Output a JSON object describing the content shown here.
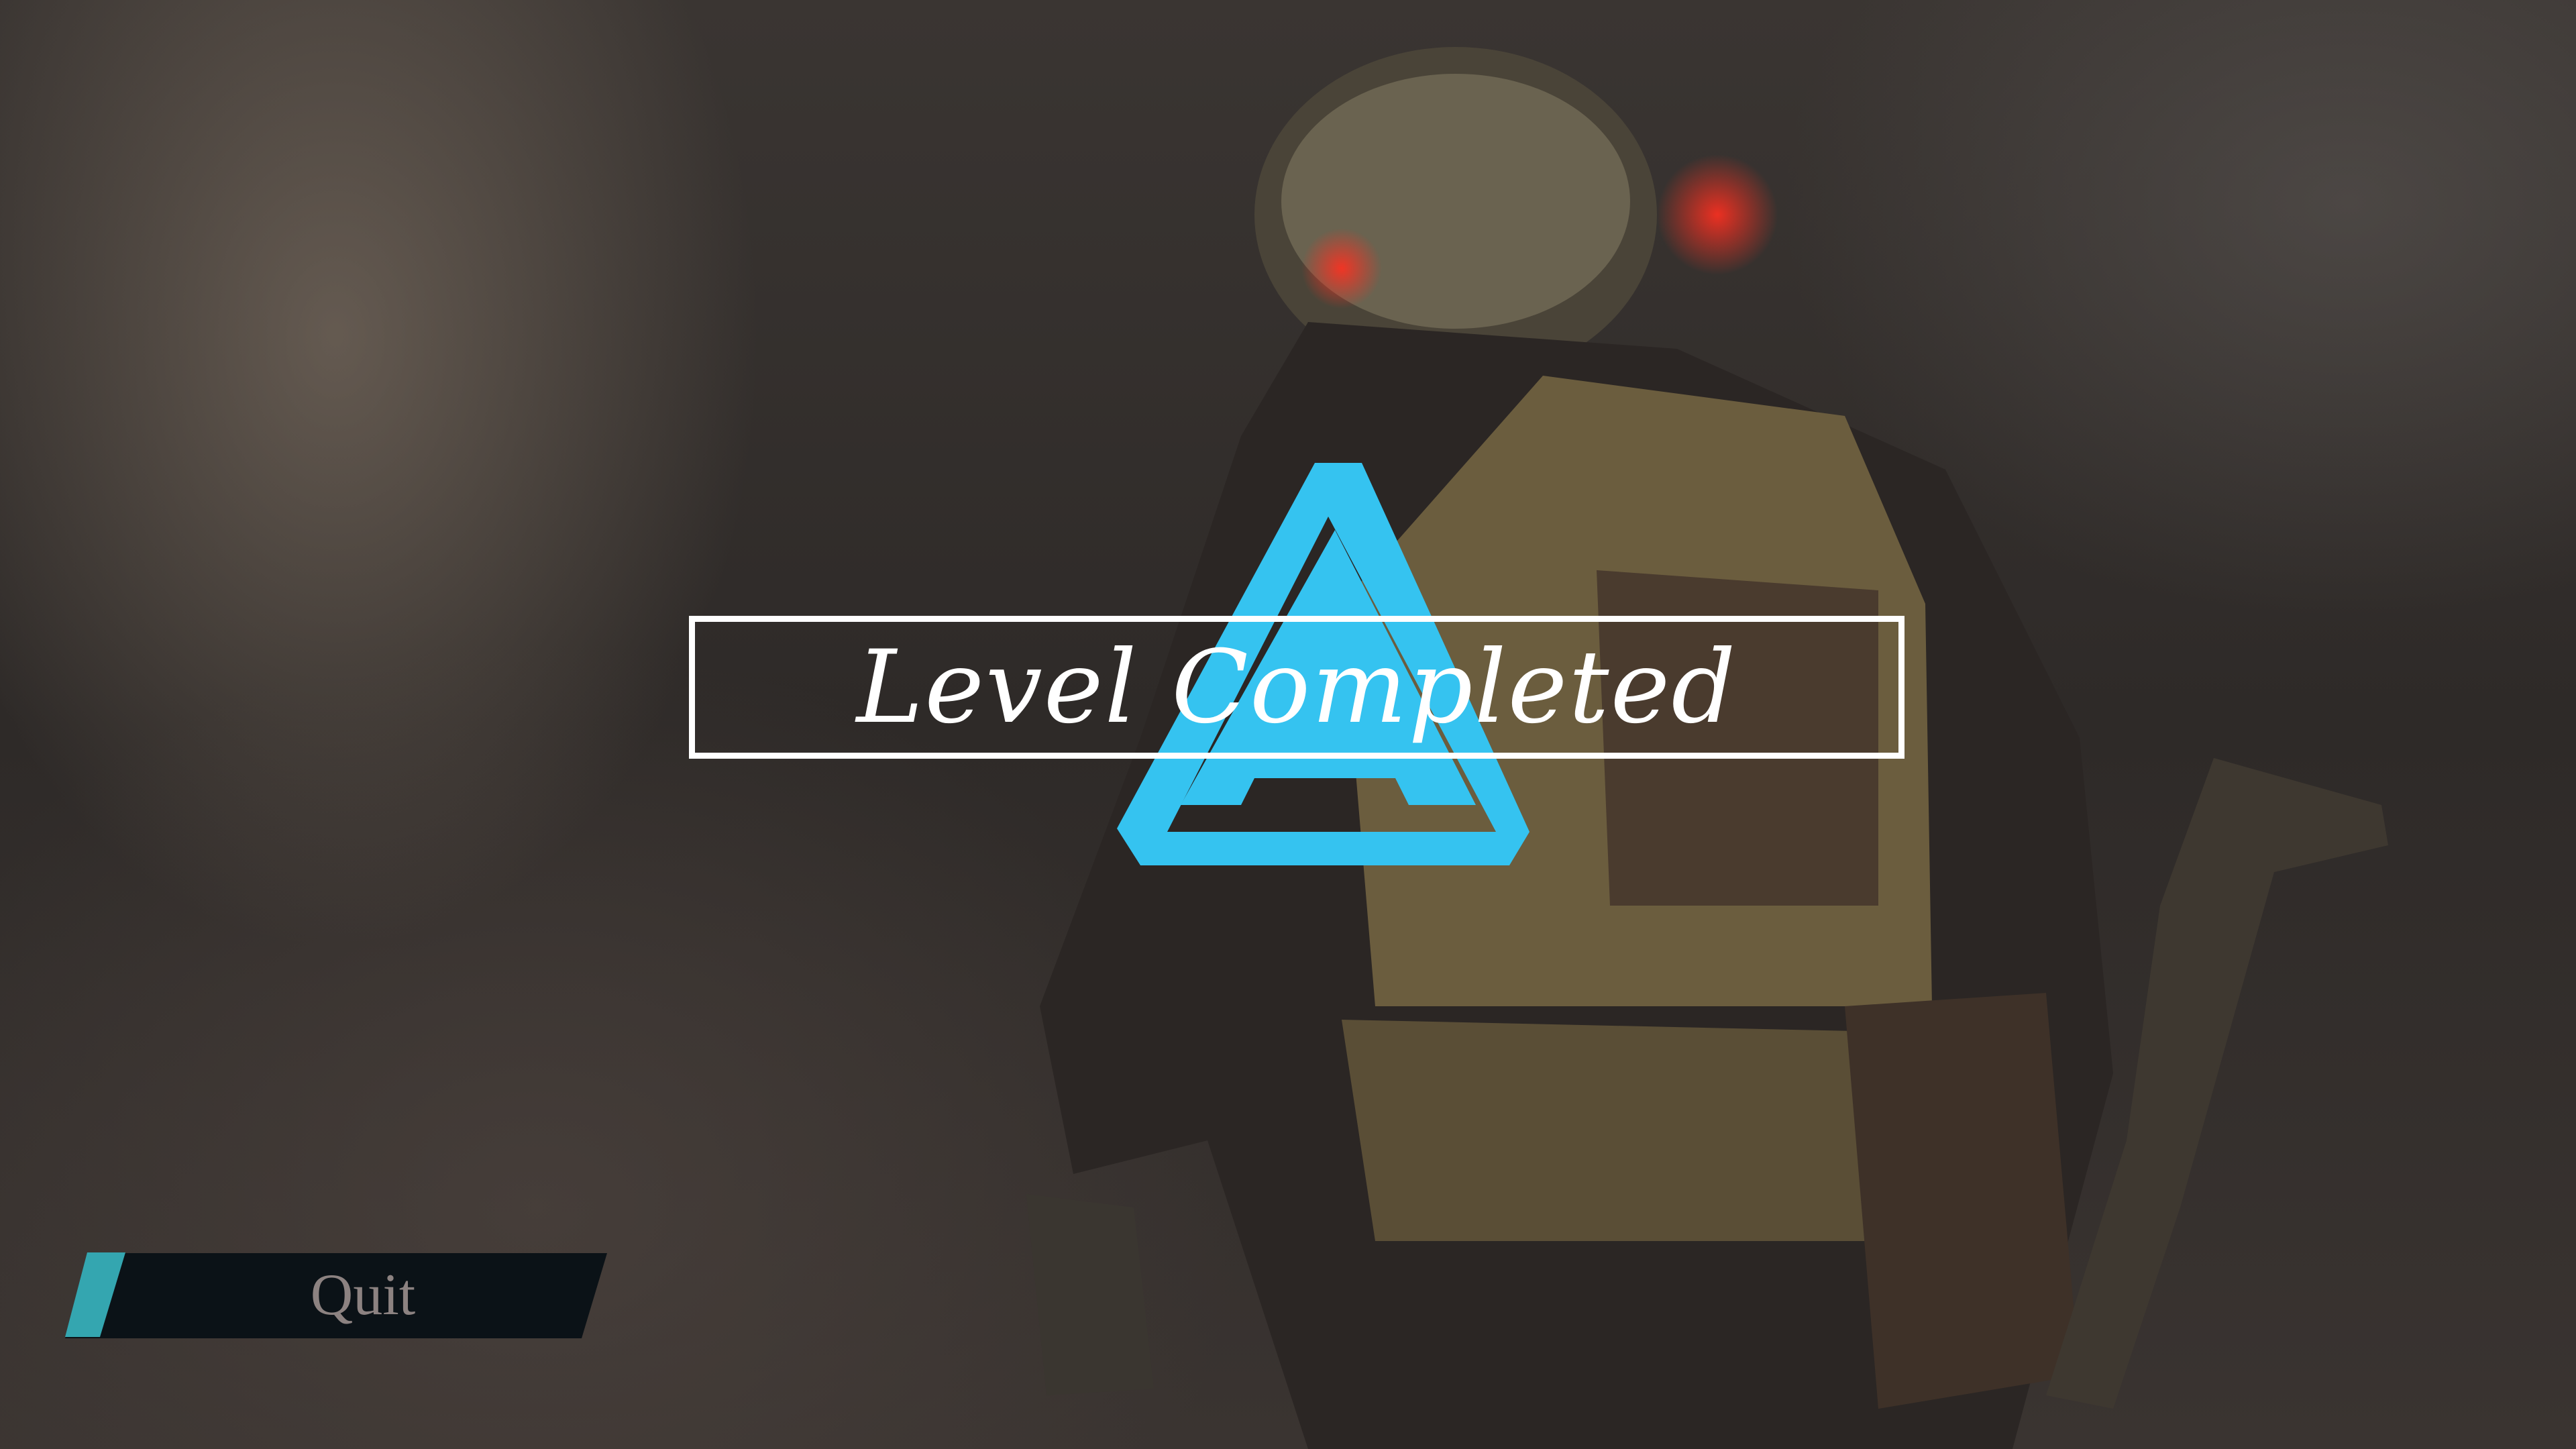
{
  "title": "Level Completed",
  "menu": {
    "quit_label": "Quit"
  },
  "colors": {
    "accent": "#35c3f0",
    "button_bg": "#0b1217",
    "button_stripe": "#34a6b0",
    "button_text": "#8c8281"
  },
  "icons": {
    "logo": "triangle-a-logo-icon"
  }
}
